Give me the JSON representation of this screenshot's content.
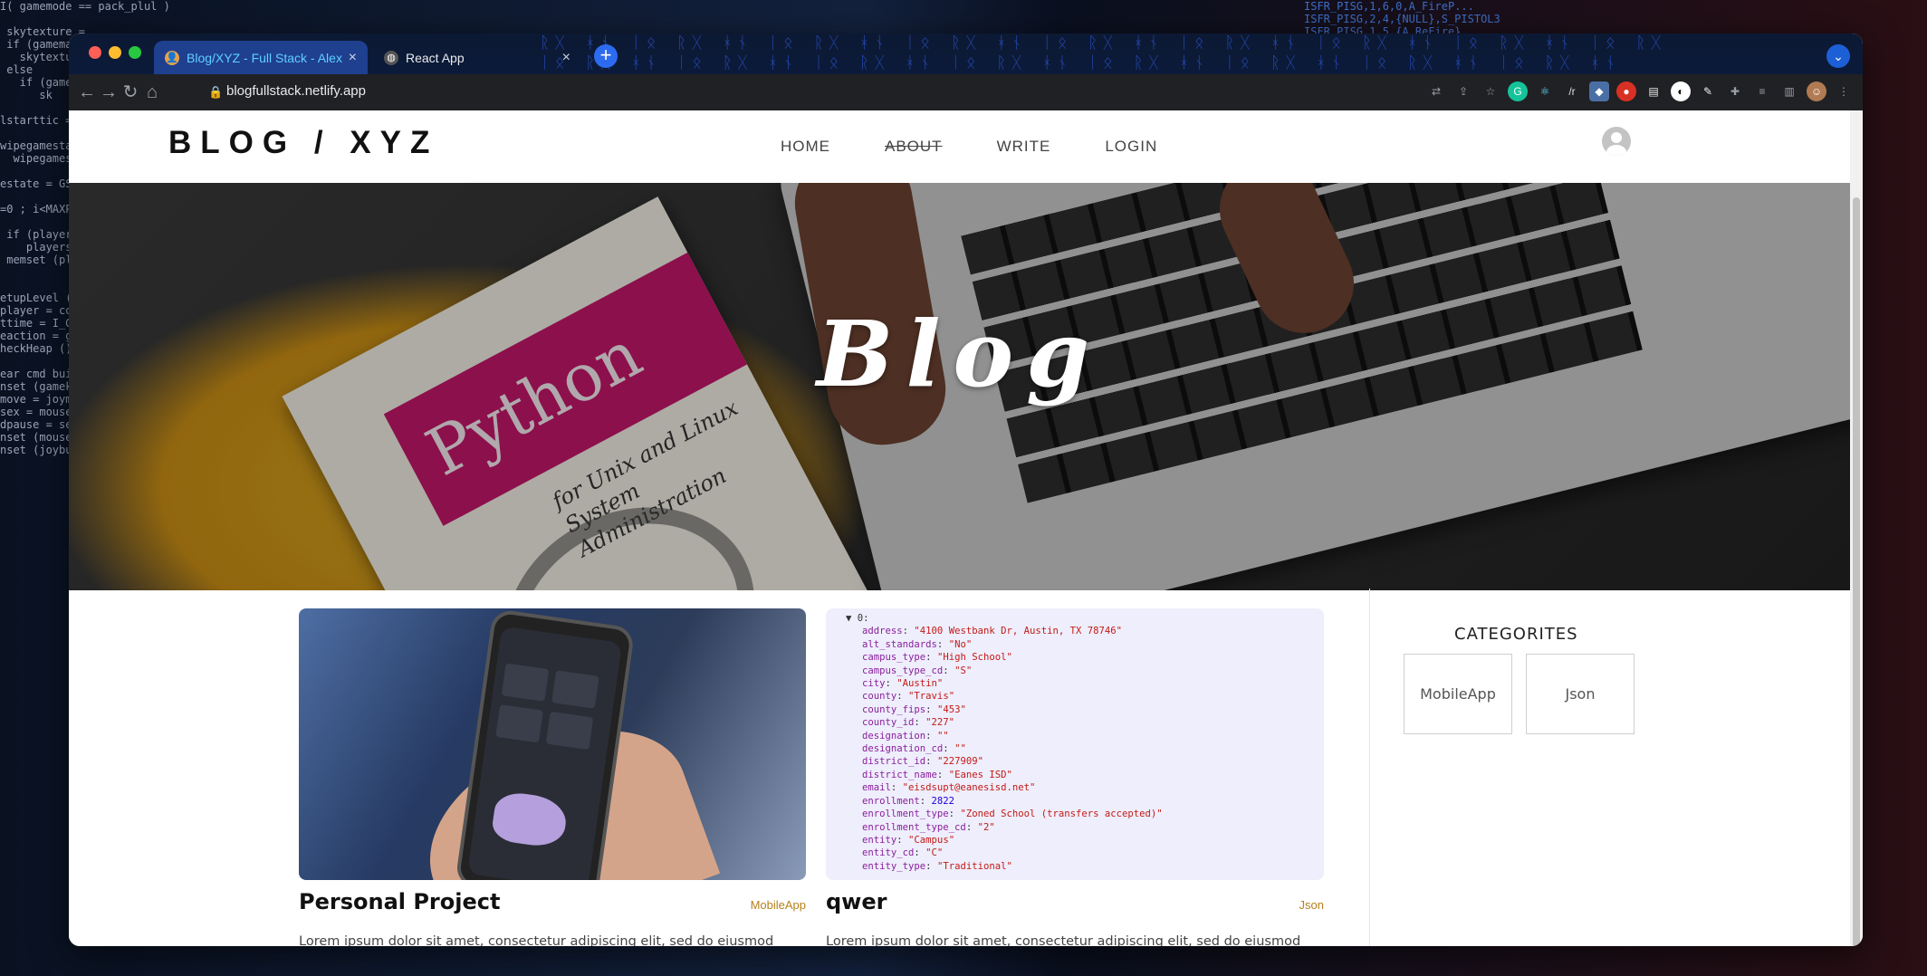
{
  "browser": {
    "tabs": [
      {
        "title": "Blog/XYZ - Full Stack - Alex Zi",
        "active": true
      },
      {
        "title": "React App",
        "active": false
      }
    ],
    "url": "blogfullstack.netlify.app"
  },
  "site": {
    "logo": "BLOG / XYZ",
    "menu": [
      "HOME",
      "ABOUT",
      "WRITE",
      "LOGIN"
    ],
    "hero_title": "Blog"
  },
  "posts": [
    {
      "title": "Personal Project",
      "category": "MobileApp",
      "description": "Lorem ipsum dolor sit amet, consectetur adipiscing elit, sed do eiusmod"
    },
    {
      "title": "qwer",
      "category": "Json",
      "description": "Lorem ipsum dolor sit amet, consectetur adipiscing elit, sed do eiusmod",
      "json_preview": [
        {
          "k": "▼ 0:",
          "v": "",
          "t": "head"
        },
        {
          "k": "address",
          "v": "\"4100 Westbank Dr, Austin, TX 78746\"",
          "t": "str"
        },
        {
          "k": "alt_standards",
          "v": "\"No\"",
          "t": "str"
        },
        {
          "k": "campus_type",
          "v": "\"High School\"",
          "t": "str"
        },
        {
          "k": "campus_type_cd",
          "v": "\"S\"",
          "t": "str"
        },
        {
          "k": "city",
          "v": "\"Austin\"",
          "t": "str"
        },
        {
          "k": "county",
          "v": "\"Travis\"",
          "t": "str"
        },
        {
          "k": "county_fips",
          "v": "\"453\"",
          "t": "str"
        },
        {
          "k": "county_id",
          "v": "\"227\"",
          "t": "str"
        },
        {
          "k": "designation",
          "v": "\"\"",
          "t": "str"
        },
        {
          "k": "designation_cd",
          "v": "\"\"",
          "t": "str"
        },
        {
          "k": "district_id",
          "v": "\"227909\"",
          "t": "str"
        },
        {
          "k": "district_name",
          "v": "\"Eanes ISD\"",
          "t": "str"
        },
        {
          "k": "email",
          "v": "\"eisdsupt@eanesisd.net\"",
          "t": "str"
        },
        {
          "k": "enrollment",
          "v": "2822",
          "t": "num"
        },
        {
          "k": "enrollment_type",
          "v": "\"Zoned School (transfers accepted)\"",
          "t": "str"
        },
        {
          "k": "enrollment_type_cd",
          "v": "\"2\"",
          "t": "str"
        },
        {
          "k": "entity",
          "v": "\"Campus\"",
          "t": "str"
        },
        {
          "k": "entity_cd",
          "v": "\"C\"",
          "t": "str"
        },
        {
          "k": "entity_type",
          "v": "\"Traditional\"",
          "t": "str"
        }
      ]
    }
  ],
  "sidebar": {
    "title": "CATEGORITES",
    "categories": [
      "MobileApp",
      "Json"
    ]
  },
  "colors": {
    "category_text": "#b5811a",
    "active_tab": "#1f3f8f"
  }
}
